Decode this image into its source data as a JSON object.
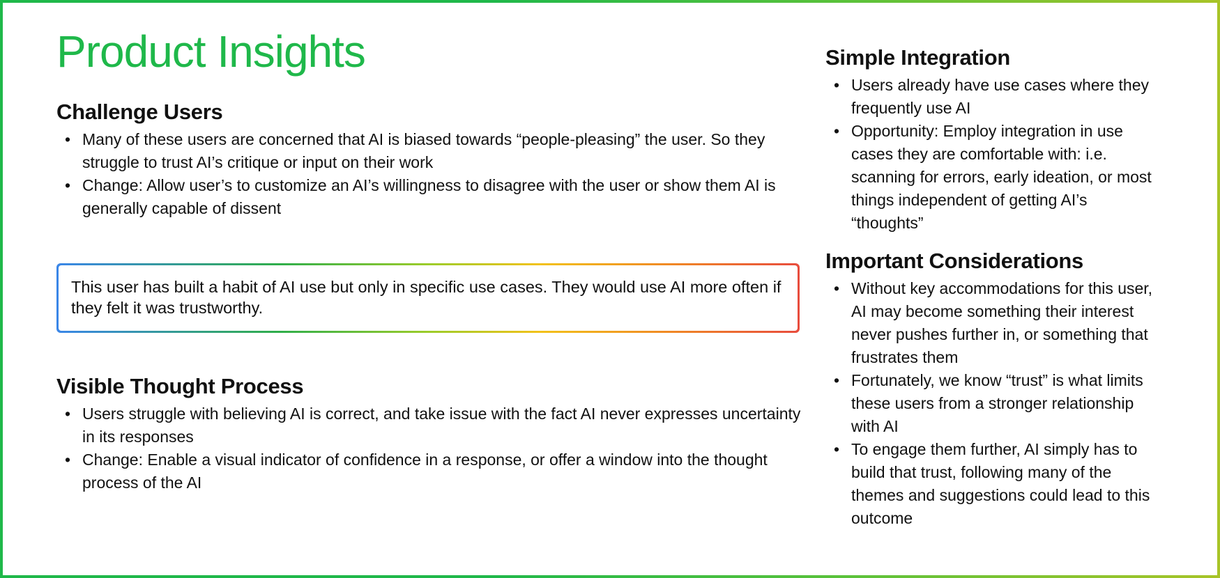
{
  "title": "Product Insights",
  "theme": {
    "accent": "#1fb84a",
    "callout_gradient": [
      "#3a86e8",
      "#2fae4a",
      "#f2c21a",
      "#f08a24",
      "#e84c3d"
    ]
  },
  "sections": {
    "challenge_users": {
      "heading": "Challenge Users",
      "bullets": [
        "Many of these users are concerned that AI is biased towards “people-pleasing” the user. So they struggle to trust AI’s critique or input on their work",
        "Change: Allow user’s to customize an AI’s willingness to disagree with the user or show them AI is generally capable of dissent"
      ]
    },
    "visible_thought": {
      "heading": "Visible Thought Process",
      "bullets": [
        "Users struggle with believing AI is correct, and take issue with the fact AI never expresses uncertainty in its responses",
        "Change: Enable a visual indicator of confidence in a response, or offer a window into the thought process of the AI"
      ]
    },
    "simple_integration": {
      "heading": "Simple Integration",
      "bullets": [
        "Users already have use cases where they frequently use AI",
        "Opportunity: Employ integration in use cases they are comfortable with: i.e. scanning for errors, early ideation, or most things independent of getting AI’s “thoughts”"
      ]
    },
    "important_considerations": {
      "heading": "Important Considerations",
      "bullets": [
        "Without key accommodations for this user, AI may become something their interest never pushes further in, or something that frustrates them",
        "Fortunately, we know “trust” is what limits these users from a stronger relationship with AI",
        "To engage them further, AI simply has to build that trust, following many of the themes and suggestions could lead to this outcome"
      ]
    }
  },
  "callout": {
    "text": "This user has built a habit of AI use but only in specific use cases. They would use AI more often if they felt it was trustworthy."
  }
}
